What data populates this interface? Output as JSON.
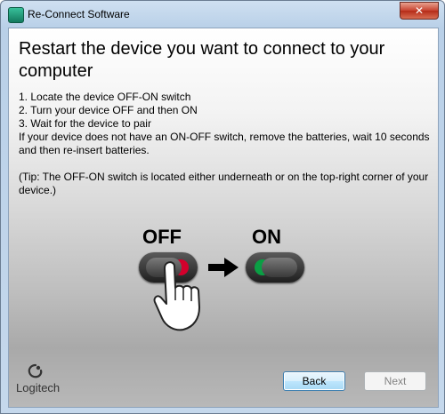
{
  "window": {
    "title": "Re-Connect Software",
    "close_label": "✕"
  },
  "main": {
    "heading": "Restart the device you want to connect to your computer",
    "steps": [
      "1. Locate the device OFF-ON switch",
      "2. Turn your device OFF and then ON",
      "3. Wait for the device to pair"
    ],
    "note": "If your device does not have an ON-OFF switch, remove the batteries, wait 10 seconds and then re-insert batteries.",
    "tip": "(Tip: The OFF-ON switch is located either underneath or on the top-right corner of your device.)"
  },
  "illustration": {
    "off_label": "OFF",
    "on_label": "ON",
    "off_accent_color": "#d3002c",
    "on_accent_color": "#0a9f44",
    "icons": [
      "switch-off-icon",
      "arrow-right-icon",
      "switch-on-icon",
      "pointing-hand-icon"
    ]
  },
  "footer": {
    "logo_text": "Logitech",
    "back_label": "Back",
    "next_label": "Next"
  }
}
